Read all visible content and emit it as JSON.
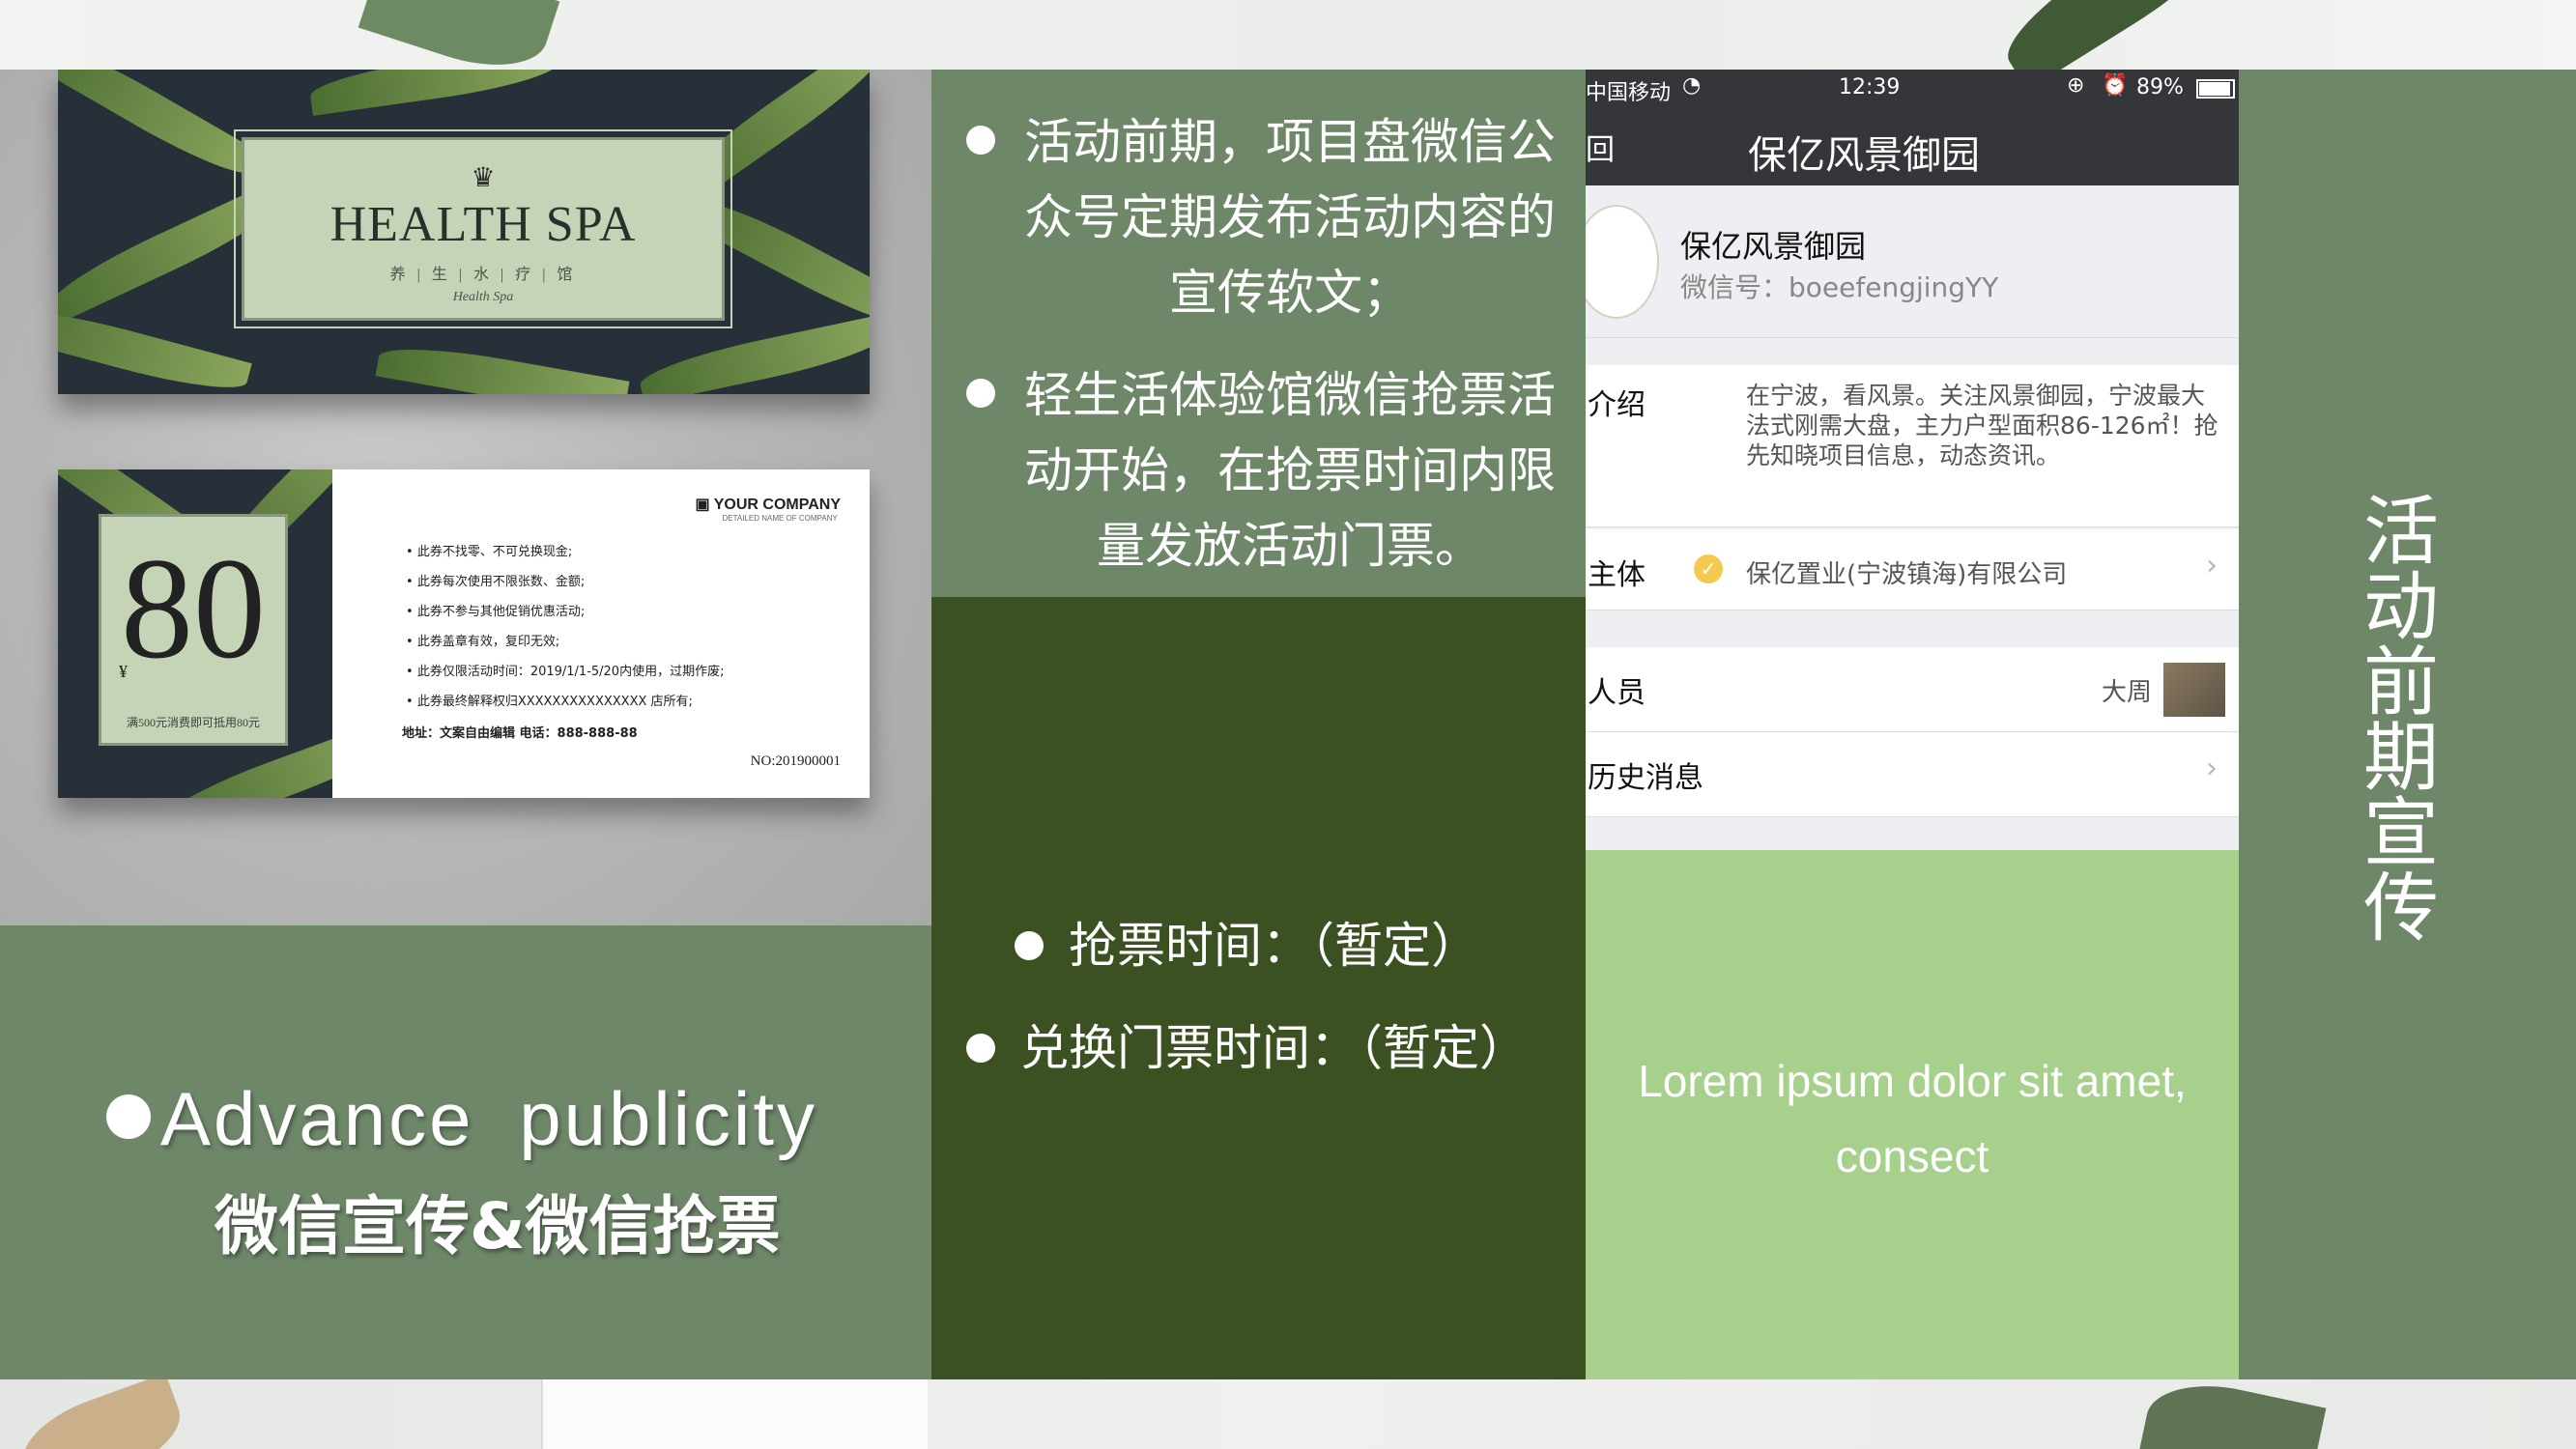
{
  "left_photo": {
    "voucher_front": {
      "title": "HEALTH SPA",
      "subtitle": "养 | 生 | 水 | 疗 | 馆",
      "script": "Health Spa"
    },
    "voucher_back": {
      "value": "80",
      "currency": "¥",
      "value_note": "满500元消费即可抵用80元",
      "company": "YOUR COMPANY",
      "company_sub": "DETAILED NAME OF COMPANY",
      "rules": [
        "此券不找零、不可兑换现金;",
        "此券每次使用不限张数、金额;",
        "此券不参与其他促销优惠活动;",
        "此券盖章有效，复印无效;",
        "此券仅限活动时间：2019/1/1-5/20内使用，过期作废;",
        "此券最终解释权归XXXXXXXXXXXXXXX 店所有;"
      ],
      "address": "地址：文案自由编辑    电话：888-888-88",
      "number": "NO:201900001"
    }
  },
  "left_caption": {
    "english": "Advance  publicity",
    "chinese": "微信宣传&微信抢票"
  },
  "middle": {
    "bullet1": [
      "活动前期，项目盘微信公",
      "众号定期发布活动内容的",
      "宣传软文；"
    ],
    "bullet2": [
      "轻生活体验馆微信抢票活",
      "动开始，在抢票时间内限",
      "量发放活动门票。"
    ],
    "bullet3": "抢票时间：（暂定）",
    "bullet4": "兑换门票时间：（暂定）"
  },
  "phone": {
    "status": {
      "carrier": "中国移动",
      "time": "12:39",
      "battery": "89%"
    },
    "nav": {
      "back": "回",
      "title": "保亿风景御园"
    },
    "account": {
      "name": "保亿风景御园",
      "wechat_id": "微信号：boeefengjingYY"
    },
    "intro": {
      "label": "介绍",
      "text": "在宁波，看风景。关注风景御园，宁波最大法式刚需大盘，主力户型面积86-126㎡！抢先知晓项目信息，动态资讯。"
    },
    "subject": {
      "label": "主体",
      "value": "保亿置业(宁波镇海)有限公司"
    },
    "staff": {
      "label": "人员",
      "value": "大周"
    },
    "history": {
      "label": "历史消息"
    }
  },
  "lorem": [
    "Lorem ipsum dolor sit amet,",
    "consect"
  ],
  "right_title": "活动前期宣传",
  "colors": {
    "sage": "#6e8769",
    "forest": "#3b5122",
    "light_green": "#a6d08c",
    "phone_bar": "#35363a"
  }
}
